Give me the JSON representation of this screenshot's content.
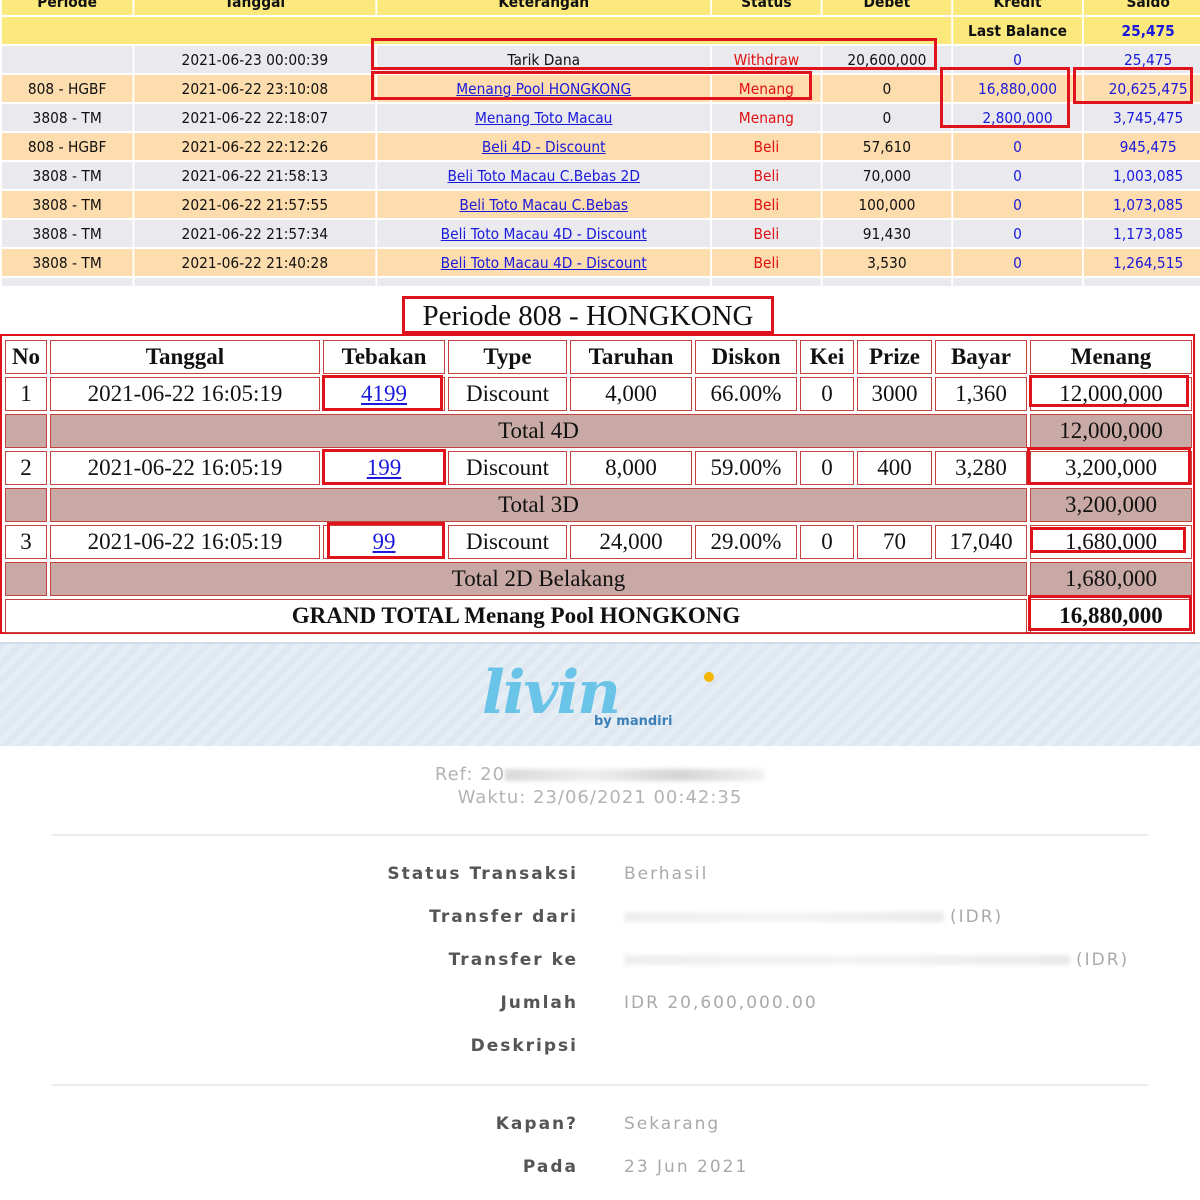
{
  "history": {
    "columns": [
      "Periode",
      "Tanggal",
      "Keterangan",
      "Status",
      "Debet",
      "Kredit",
      "Saldo"
    ],
    "last_balance_label": "Last Balance",
    "last_balance_value": "25,475",
    "rows": [
      {
        "periode": "",
        "tanggal": "2021-06-23 00:00:39",
        "keterangan": "Tarik Dana",
        "status": "Withdraw",
        "debet": "20,600,000",
        "kredit": "0",
        "saldo": "25,475"
      },
      {
        "periode": "808 - HGBF",
        "tanggal": "2021-06-22 23:10:08",
        "keterangan": "Menang Pool HONGKONG",
        "status": "Menang",
        "debet": "0",
        "kredit": "16,880,000",
        "saldo": "20,625,475"
      },
      {
        "periode": "3808 - TM",
        "tanggal": "2021-06-22 22:18:07",
        "keterangan": "Menang Toto Macau",
        "status": "Menang",
        "debet": "0",
        "kredit": "2,800,000",
        "saldo": "3,745,475"
      },
      {
        "periode": "808 - HGBF",
        "tanggal": "2021-06-22 22:12:26",
        "keterangan": "Beli 4D - Discount",
        "status": "Beli",
        "debet": "57,610",
        "kredit": "0",
        "saldo": "945,475"
      },
      {
        "periode": "3808 - TM",
        "tanggal": "2021-06-22 21:58:13",
        "keterangan": "Beli Toto Macau C.Bebas 2D",
        "status": "Beli",
        "debet": "70,000",
        "kredit": "0",
        "saldo": "1,003,085"
      },
      {
        "periode": "3808 - TM",
        "tanggal": "2021-06-22 21:57:55",
        "keterangan": "Beli Toto Macau C.Bebas",
        "status": "Beli",
        "debet": "100,000",
        "kredit": "0",
        "saldo": "1,073,085"
      },
      {
        "periode": "3808 - TM",
        "tanggal": "2021-06-22 21:57:34",
        "keterangan": "Beli Toto Macau 4D - Discount",
        "status": "Beli",
        "debet": "91,430",
        "kredit": "0",
        "saldo": "1,173,085"
      },
      {
        "periode": "3808 - TM",
        "tanggal": "2021-06-22 21:40:28",
        "keterangan": "Beli Toto Macau 4D - Discount",
        "status": "Beli",
        "debet": "3,530",
        "kredit": "0",
        "saldo": "1,264,515"
      }
    ]
  },
  "periode": {
    "title": "Periode 808 - HONGKONG",
    "columns": [
      "No",
      "Tanggal",
      "Tebakan",
      "Type",
      "Taruhan",
      "Diskon",
      "Kei",
      "Prize",
      "Bayar",
      "Menang"
    ],
    "rows": [
      {
        "no": "1",
        "tanggal": "2021-06-22 16:05:19",
        "tebakan": "4199",
        "type": "Discount",
        "taruhan": "4,000",
        "diskon": "66.00%",
        "kei": "0",
        "prize": "3000",
        "bayar": "1,360",
        "menang": "12,000,000",
        "total_label": "Total 4D",
        "total_value": "12,000,000"
      },
      {
        "no": "2",
        "tanggal": "2021-06-22 16:05:19",
        "tebakan": "199",
        "type": "Discount",
        "taruhan": "8,000",
        "diskon": "59.00%",
        "kei": "0",
        "prize": "400",
        "bayar": "3,280",
        "menang": "3,200,000",
        "total_label": "Total 3D",
        "total_value": "3,200,000"
      },
      {
        "no": "3",
        "tanggal": "2021-06-22 16:05:19",
        "tebakan": "99",
        "type": "Discount",
        "taruhan": "24,000",
        "diskon": "29.00%",
        "kei": "0",
        "prize": "70",
        "bayar": "17,040",
        "menang": "1,680,000",
        "total_label": "Total 2D Belakang",
        "total_value": "1,680,000"
      }
    ],
    "grand_total_label": "GRAND TOTAL  Menang Pool HONGKONG",
    "grand_total_value": "16,880,000"
  },
  "receipt": {
    "logo_word": "livin",
    "logo_by": "by mandiri",
    "ref_label": "Ref: 20",
    "waktu": "Waktu: 23/06/2021 00:42:35",
    "fields": [
      {
        "label": "Status Transaksi",
        "value": "Berhasil"
      },
      {
        "label": "Transfer dari",
        "value": "(IDR)"
      },
      {
        "label": "Transfer ke",
        "value": "(IDR)"
      },
      {
        "label": "Jumlah",
        "value": "IDR 20,600,000.00"
      },
      {
        "label": "Deskripsi",
        "value": ""
      }
    ],
    "fields2": [
      {
        "label": "Kapan?",
        "value": "Sekarang"
      },
      {
        "label": "Pada",
        "value": "23 Jun 2021"
      }
    ]
  },
  "colors": {
    "highlight": "#e0131c",
    "link": "#1a1adc",
    "header_yellow": "#fce97d",
    "row_peach": "#fddcad",
    "row_gray": "#e9e9ee",
    "total_row": "#c9a9a5"
  }
}
